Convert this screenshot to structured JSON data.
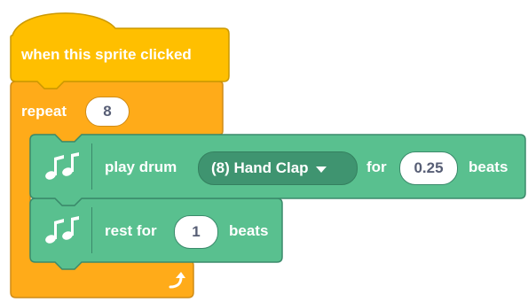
{
  "colors": {
    "control_orange": "#FFAB19",
    "events_yellow": "#FFBF00",
    "music_green": "#59C08F"
  },
  "hat_block": {
    "label": "when this sprite clicked"
  },
  "repeat_block": {
    "label": "repeat",
    "count": "8",
    "loop_icon": "loop-arrow-icon"
  },
  "play_drum_block": {
    "icon": "music-notes-icon",
    "label": "play drum",
    "drum_menu": "(8) Hand Clap",
    "for_label": "for",
    "beats_value": "0.25",
    "beats_label": "beats"
  },
  "rest_block": {
    "icon": "music-notes-icon",
    "label": "rest for",
    "beats_value": "1",
    "beats_label": "beats"
  }
}
